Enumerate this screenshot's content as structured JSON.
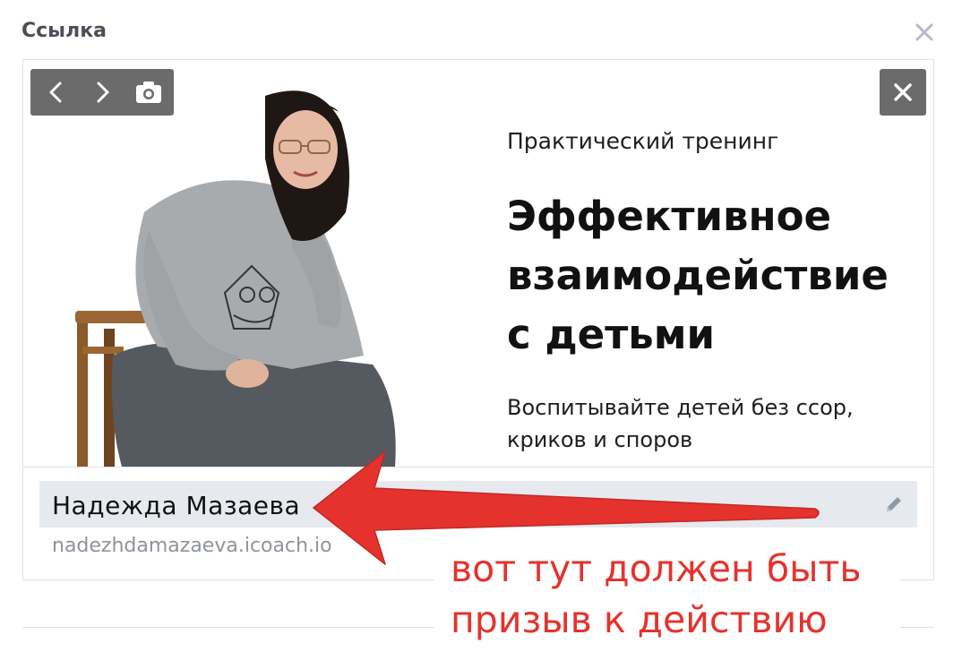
{
  "header": {
    "title": "Ссылка"
  },
  "preview": {
    "subtitle": "Практический тренинг",
    "title_lines": [
      "Эффективное",
      "взаимодействие",
      "с детьми"
    ],
    "description_lines": [
      "Воспитывайте детей без ссор,",
      "криков и споров"
    ],
    "toolbar": {
      "icons": [
        "chevron-left-icon",
        "chevron-right-icon",
        "camera-icon"
      ]
    }
  },
  "link": {
    "title": "Надежда Мазаева",
    "url": "nadezhdamazaeva.icoach.io"
  },
  "annotation": {
    "lines": [
      "вот тут должен быть",
      "призыв к действию"
    ],
    "color": "#e5322d"
  },
  "colors": {
    "accent_red": "#e5322d",
    "toolbar_bg": "#6b6b6b",
    "title_row_bg": "#e6e9ee"
  }
}
